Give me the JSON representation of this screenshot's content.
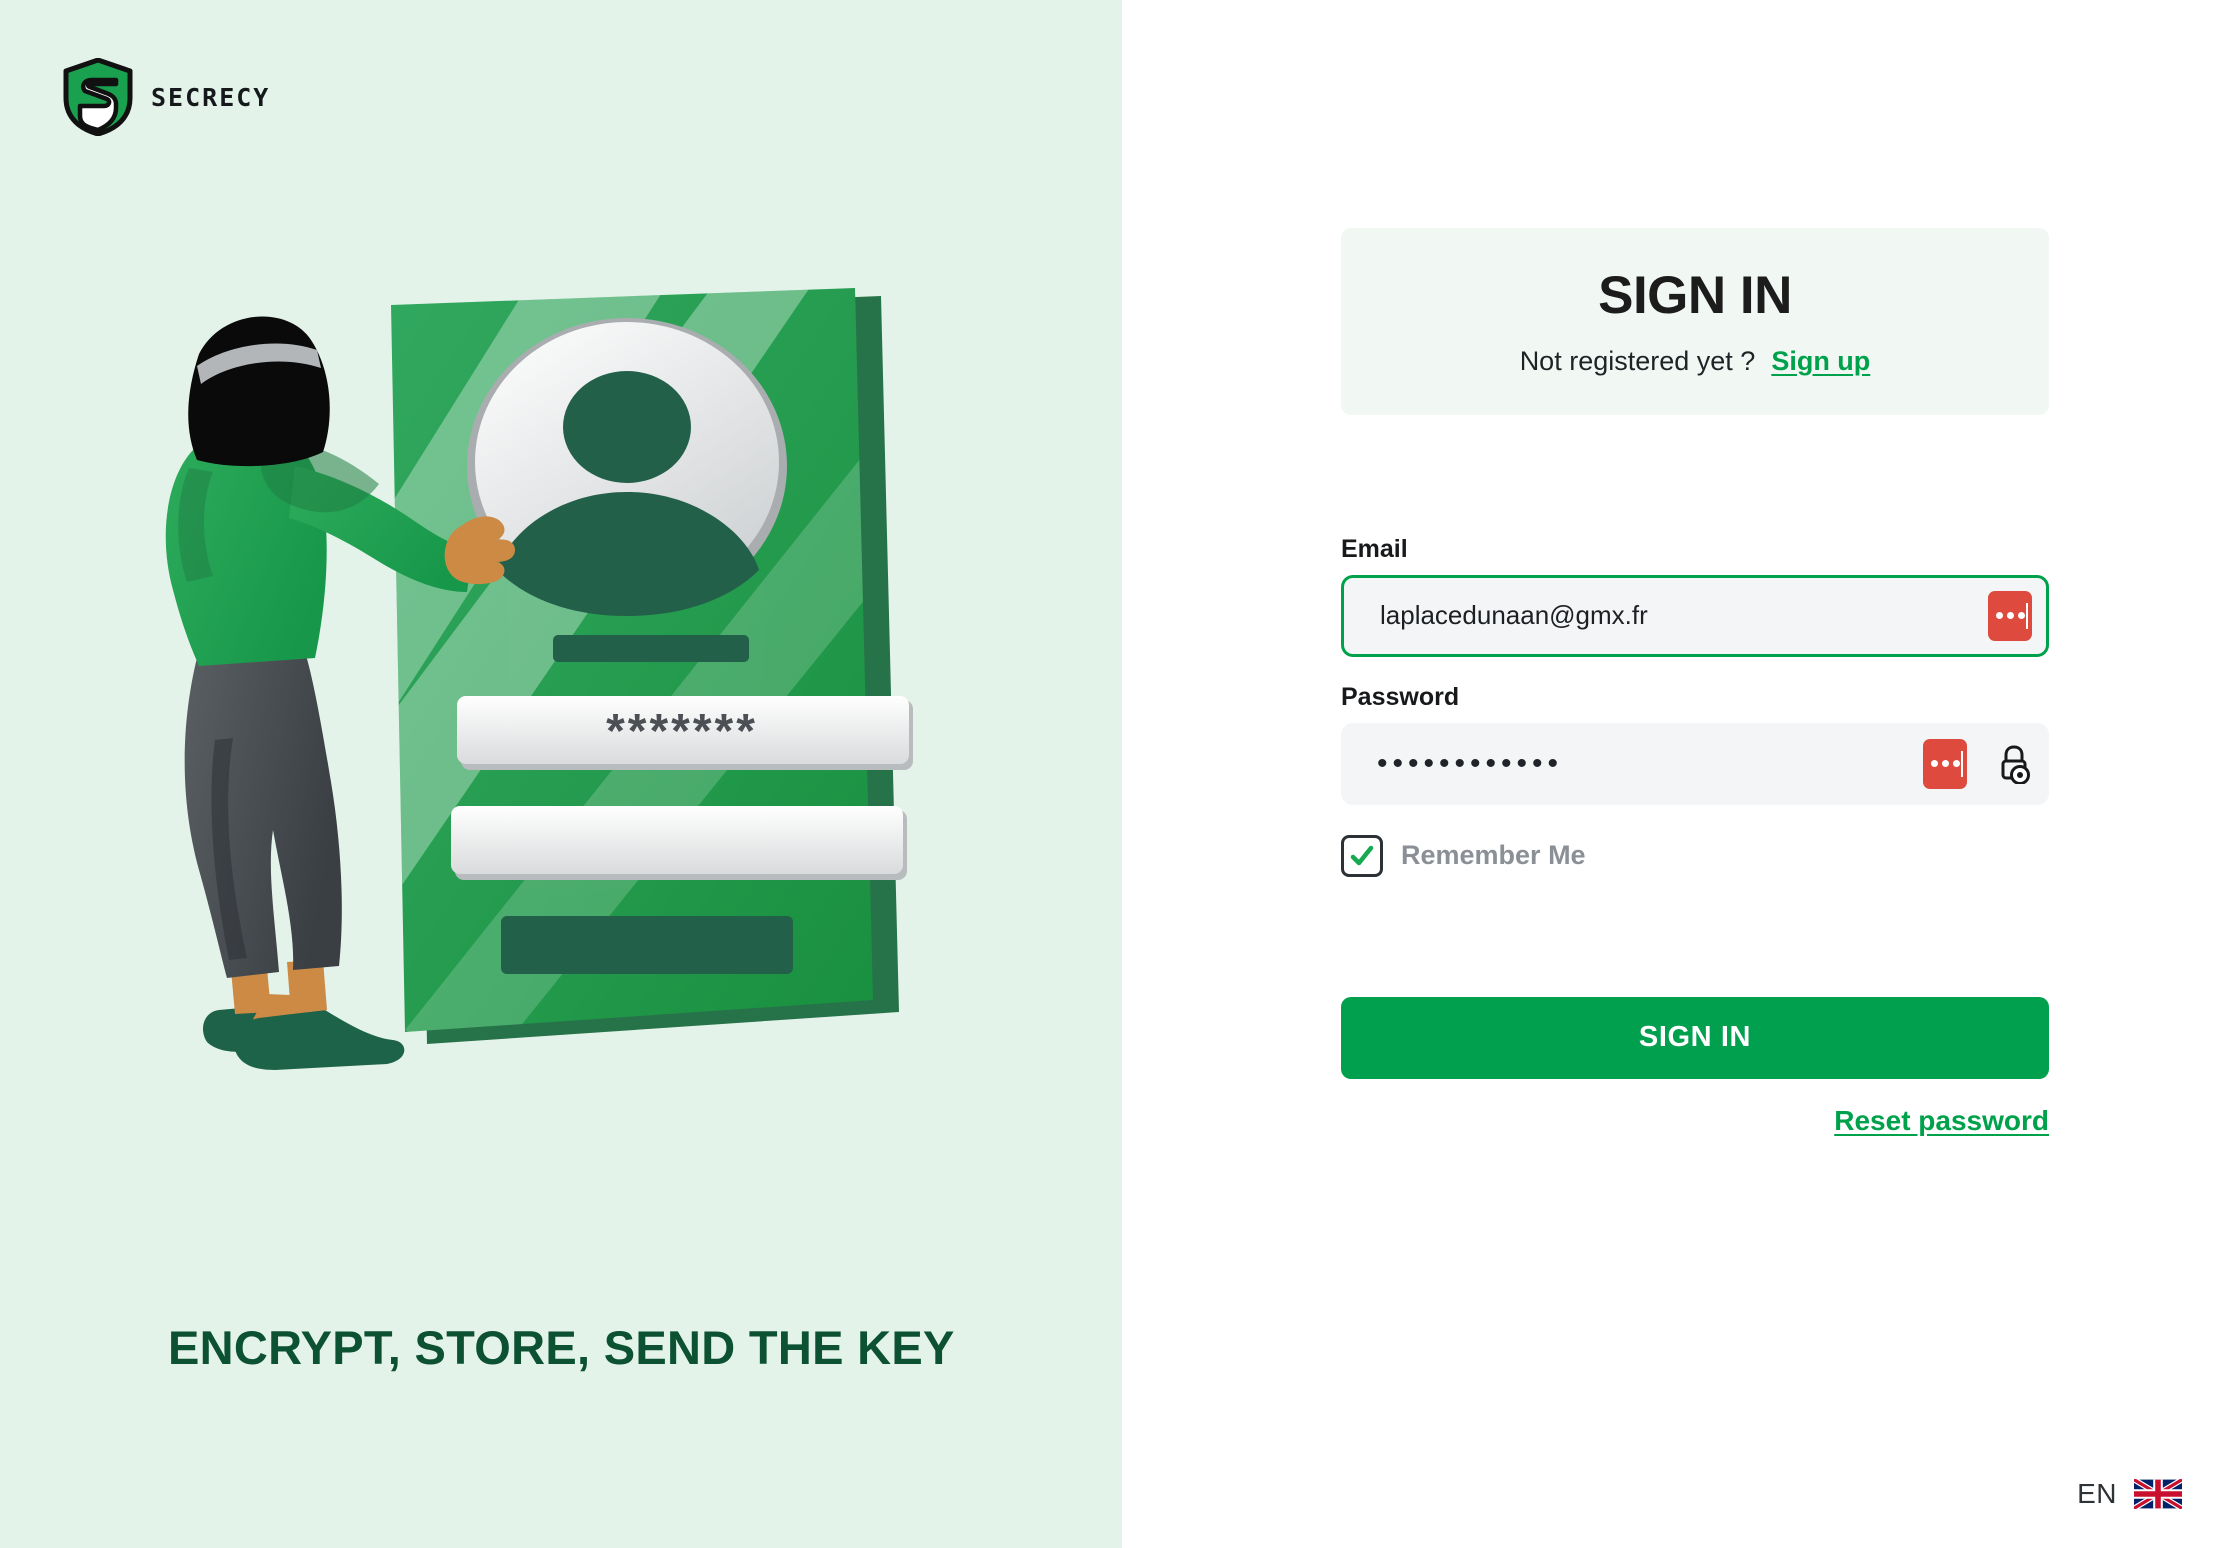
{
  "brand": {
    "name": "SECRECY",
    "logo_icon": "shield-s-logo-icon"
  },
  "left": {
    "tagline": "ENCRYPT, STORE, SEND THE KEY",
    "illustration": {
      "name": "person-at-login-card-illustration",
      "card_password_mask": "*******"
    }
  },
  "auth": {
    "title": "SIGN IN",
    "prompt": "Not registered yet ?",
    "signup_label": "Sign up",
    "email": {
      "label": "Email",
      "value": "laplacedunaan@gmx.fr",
      "placeholder": "Email",
      "manager_icon": "password-manager-icon"
    },
    "password": {
      "label": "Password",
      "value": "••••••••••••",
      "placeholder": "Password",
      "manager_icon": "password-manager-icon",
      "reveal_icon": "lock-eye-reveal-icon"
    },
    "remember": {
      "label": "Remember Me",
      "checked": true,
      "check_icon": "checkmark-icon"
    },
    "submit_label": "SIGN IN",
    "reset_label": "Reset password"
  },
  "language": {
    "code": "EN",
    "flag_icon": "uk-flag-icon"
  },
  "colors": {
    "brand_green": "#00a04f",
    "link_green": "#00a14b",
    "dark_green": "#0b5132",
    "left_bg": "#e4f3e9",
    "card_bg": "#f1f8f4",
    "input_bg": "#f4f5f6",
    "manager_red": "#de4b3e",
    "muted_gray": "#8b9096"
  }
}
